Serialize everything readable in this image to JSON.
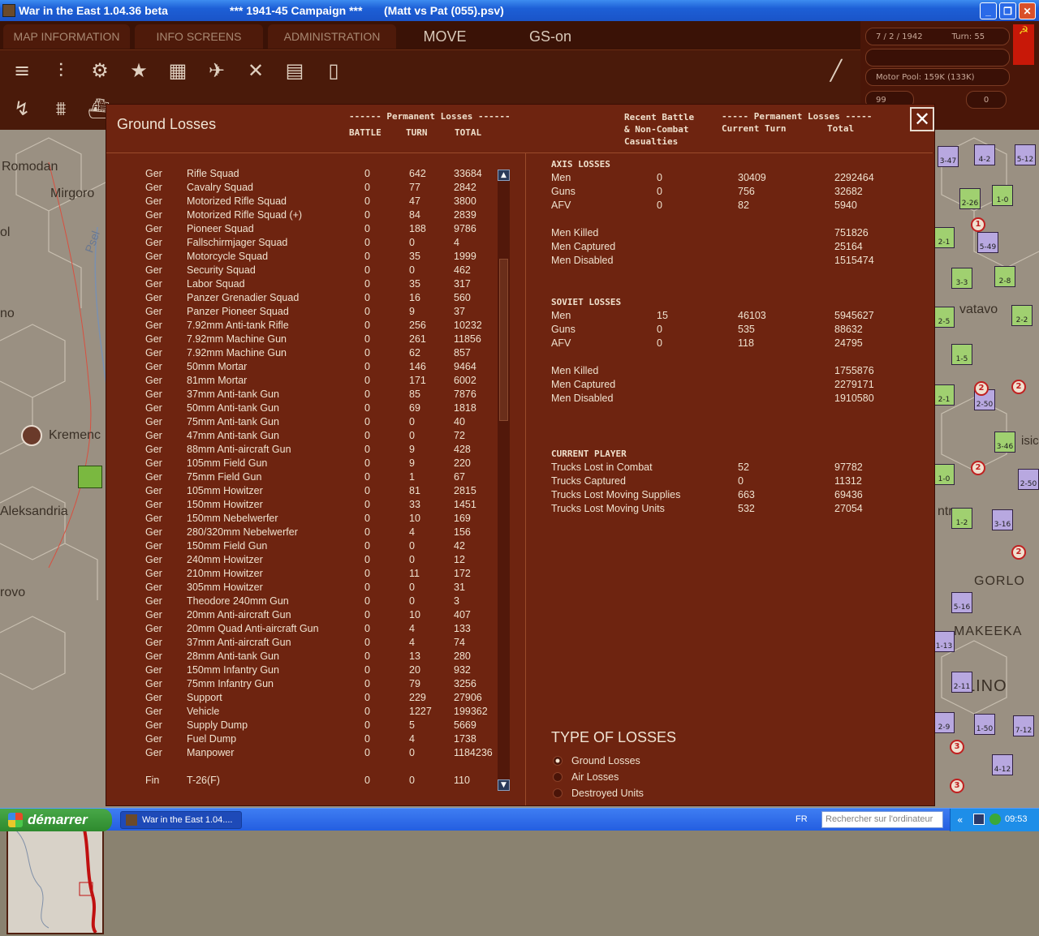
{
  "window": {
    "app_title": "War in the East 1.04.36 beta",
    "campaign": "***   1941-45 Campaign   ***",
    "save_file": "(Matt vs Pat (055).psv)"
  },
  "menu": {
    "map_information": "MAP INFORMATION",
    "info_screens": "INFO SCREENS",
    "administration": "ADMINISTRATION",
    "move": "MOVE",
    "gs_on": "GS-on"
  },
  "status": {
    "date": "7 / 2 / 1942",
    "turn": "Turn: 55",
    "motor_pool": "Motor Pool:  159K (133K)",
    "field_99": "99",
    "field_0": "0"
  },
  "map_labels": [
    "Romodan",
    "Mirgoro",
    "ol",
    "no",
    "Psel",
    "Kremenc",
    "Aleksandria",
    "rovo",
    "vatavo",
    "isic",
    "GORLO",
    "MAKEEKA",
    "LINO",
    "ntr"
  ],
  "dialog": {
    "title": "Ground Losses",
    "permanent_losses_header": "------ Permanent Losses ------",
    "col_battle": "BATTLE",
    "col_turn": "TURN",
    "col_total": "TOTAL",
    "recent_battle_header": "Recent Battle\n& Non-Combat\nCasualties",
    "permanent_losses_header2": "----- Permanent Losses -----",
    "col_current_turn": "Current Turn",
    "col_total2": "Total",
    "close_icon": "close-icon",
    "rows": [
      [
        "Ger",
        "Rifle Squad",
        "0",
        "642",
        "33684"
      ],
      [
        "Ger",
        "Cavalry Squad",
        "0",
        "77",
        "2842"
      ],
      [
        "Ger",
        "Motorized Rifle Squad",
        "0",
        "47",
        "3800"
      ],
      [
        "Ger",
        "Motorized Rifle Squad (+)",
        "0",
        "84",
        "2839"
      ],
      [
        "Ger",
        "Pioneer Squad",
        "0",
        "188",
        "9786"
      ],
      [
        "Ger",
        "Fallschirmjager Squad",
        "0",
        "0",
        "4"
      ],
      [
        "Ger",
        "Motorcycle Squad",
        "0",
        "35",
        "1999"
      ],
      [
        "Ger",
        "Security Squad",
        "0",
        "0",
        "462"
      ],
      [
        "Ger",
        "Labor Squad",
        "0",
        "35",
        "317"
      ],
      [
        "Ger",
        "Panzer Grenadier Squad",
        "0",
        "16",
        "560"
      ],
      [
        "Ger",
        "Panzer Pioneer Squad",
        "0",
        "9",
        "37"
      ],
      [
        "Ger",
        "7.92mm Anti-tank Rifle",
        "0",
        "256",
        "10232"
      ],
      [
        "Ger",
        "7.92mm Machine Gun",
        "0",
        "261",
        "11856"
      ],
      [
        "Ger",
        "7.92mm Machine Gun",
        "0",
        "62",
        "857"
      ],
      [
        "Ger",
        "50mm Mortar",
        "0",
        "146",
        "9464"
      ],
      [
        "Ger",
        "81mm Mortar",
        "0",
        "171",
        "6002"
      ],
      [
        "Ger",
        "37mm Anti-tank Gun",
        "0",
        "85",
        "7876"
      ],
      [
        "Ger",
        "50mm Anti-tank Gun",
        "0",
        "69",
        "1818"
      ],
      [
        "Ger",
        "75mm Anti-tank Gun",
        "0",
        "0",
        "40"
      ],
      [
        "Ger",
        "47mm Anti-tank Gun",
        "0",
        "0",
        "72"
      ],
      [
        "Ger",
        "88mm Anti-aircraft Gun",
        "0",
        "9",
        "428"
      ],
      [
        "Ger",
        "105mm Field Gun",
        "0",
        "9",
        "220"
      ],
      [
        "Ger",
        "75mm Field Gun",
        "0",
        "1",
        "67"
      ],
      [
        "Ger",
        "105mm Howitzer",
        "0",
        "81",
        "2815"
      ],
      [
        "Ger",
        "150mm Howitzer",
        "0",
        "33",
        "1451"
      ],
      [
        "Ger",
        "150mm Nebelwerfer",
        "0",
        "10",
        "169"
      ],
      [
        "Ger",
        "280/320mm Nebelwerfer",
        "0",
        "4",
        "156"
      ],
      [
        "Ger",
        "150mm Field Gun",
        "0",
        "0",
        "42"
      ],
      [
        "Ger",
        "240mm Howitzer",
        "0",
        "0",
        "12"
      ],
      [
        "Ger",
        "210mm Howitzer",
        "0",
        "11",
        "172"
      ],
      [
        "Ger",
        "305mm Howitzer",
        "0",
        "0",
        "31"
      ],
      [
        "Ger",
        "Theodore 240mm Gun",
        "0",
        "0",
        "3"
      ],
      [
        "Ger",
        "20mm Anti-aircraft Gun",
        "0",
        "10",
        "407"
      ],
      [
        "Ger",
        "20mm Quad Anti-aircraft Gun",
        "0",
        "4",
        "133"
      ],
      [
        "Ger",
        "37mm Anti-aircraft Gun",
        "0",
        "4",
        "74"
      ],
      [
        "Ger",
        "28mm Anti-tank Gun",
        "0",
        "13",
        "280"
      ],
      [
        "Ger",
        "150mm Infantry Gun",
        "0",
        "20",
        "932"
      ],
      [
        "Ger",
        "75mm Infantry Gun",
        "0",
        "79",
        "3256"
      ],
      [
        "Ger",
        "Support",
        "0",
        "229",
        "27906"
      ],
      [
        "Ger",
        "Vehicle",
        "0",
        "1227",
        "199362"
      ],
      [
        "Ger",
        "Supply Dump",
        "0",
        "5",
        "5669"
      ],
      [
        "Ger",
        "Fuel Dump",
        "0",
        "4",
        "1738"
      ],
      [
        "Ger",
        "Manpower",
        "0",
        "0",
        "1184236"
      ],
      [
        "Fin",
        "T-26(F)",
        "0",
        "0",
        "110"
      ]
    ],
    "axis": {
      "title": "AXIS LOSSES",
      "rows": [
        [
          "Men",
          "0",
          "30409",
          "2292464"
        ],
        [
          "Guns",
          "0",
          "756",
          "32682"
        ],
        [
          "AFV",
          "0",
          "82",
          "5940"
        ]
      ],
      "extra": [
        [
          "Men Killed",
          "751826"
        ],
        [
          "Men Captured",
          "25164"
        ],
        [
          "Men Disabled",
          "1515474"
        ]
      ]
    },
    "soviet": {
      "title": "SOVIET LOSSES",
      "rows": [
        [
          "Men",
          "15",
          "46103",
          "5945627"
        ],
        [
          "Guns",
          "0",
          "535",
          "88632"
        ],
        [
          "AFV",
          "0",
          "118",
          "24795"
        ]
      ],
      "extra": [
        [
          "Men Killed",
          "1755876"
        ],
        [
          "Men Captured",
          "2279171"
        ],
        [
          "Men Disabled",
          "1910580"
        ]
      ]
    },
    "current_player": {
      "title": "CURRENT PLAYER",
      "rows": [
        [
          "Trucks Lost in Combat",
          "52",
          "97782"
        ],
        [
          "Trucks Captured",
          "0",
          "11312"
        ],
        [
          "Trucks Lost Moving Supplies",
          "663",
          "69436"
        ],
        [
          "Trucks Lost Moving Units",
          "532",
          "27054"
        ]
      ]
    },
    "type_of_losses": {
      "title": "TYPE OF LOSSES",
      "options": [
        "Ground Losses",
        "Air Losses",
        "Destroyed Units"
      ],
      "selected": "Ground Losses"
    }
  },
  "taskbar": {
    "start": "démarrer",
    "task_item": "War in the East 1.04....",
    "language": "FR",
    "search_placeholder": "Rechercher sur l'ordinateur",
    "clock": "09:53"
  },
  "colors": {
    "dialog_bg": "#6e2410",
    "taskbar": "#245ee0",
    "start": "#2e8a2e"
  }
}
